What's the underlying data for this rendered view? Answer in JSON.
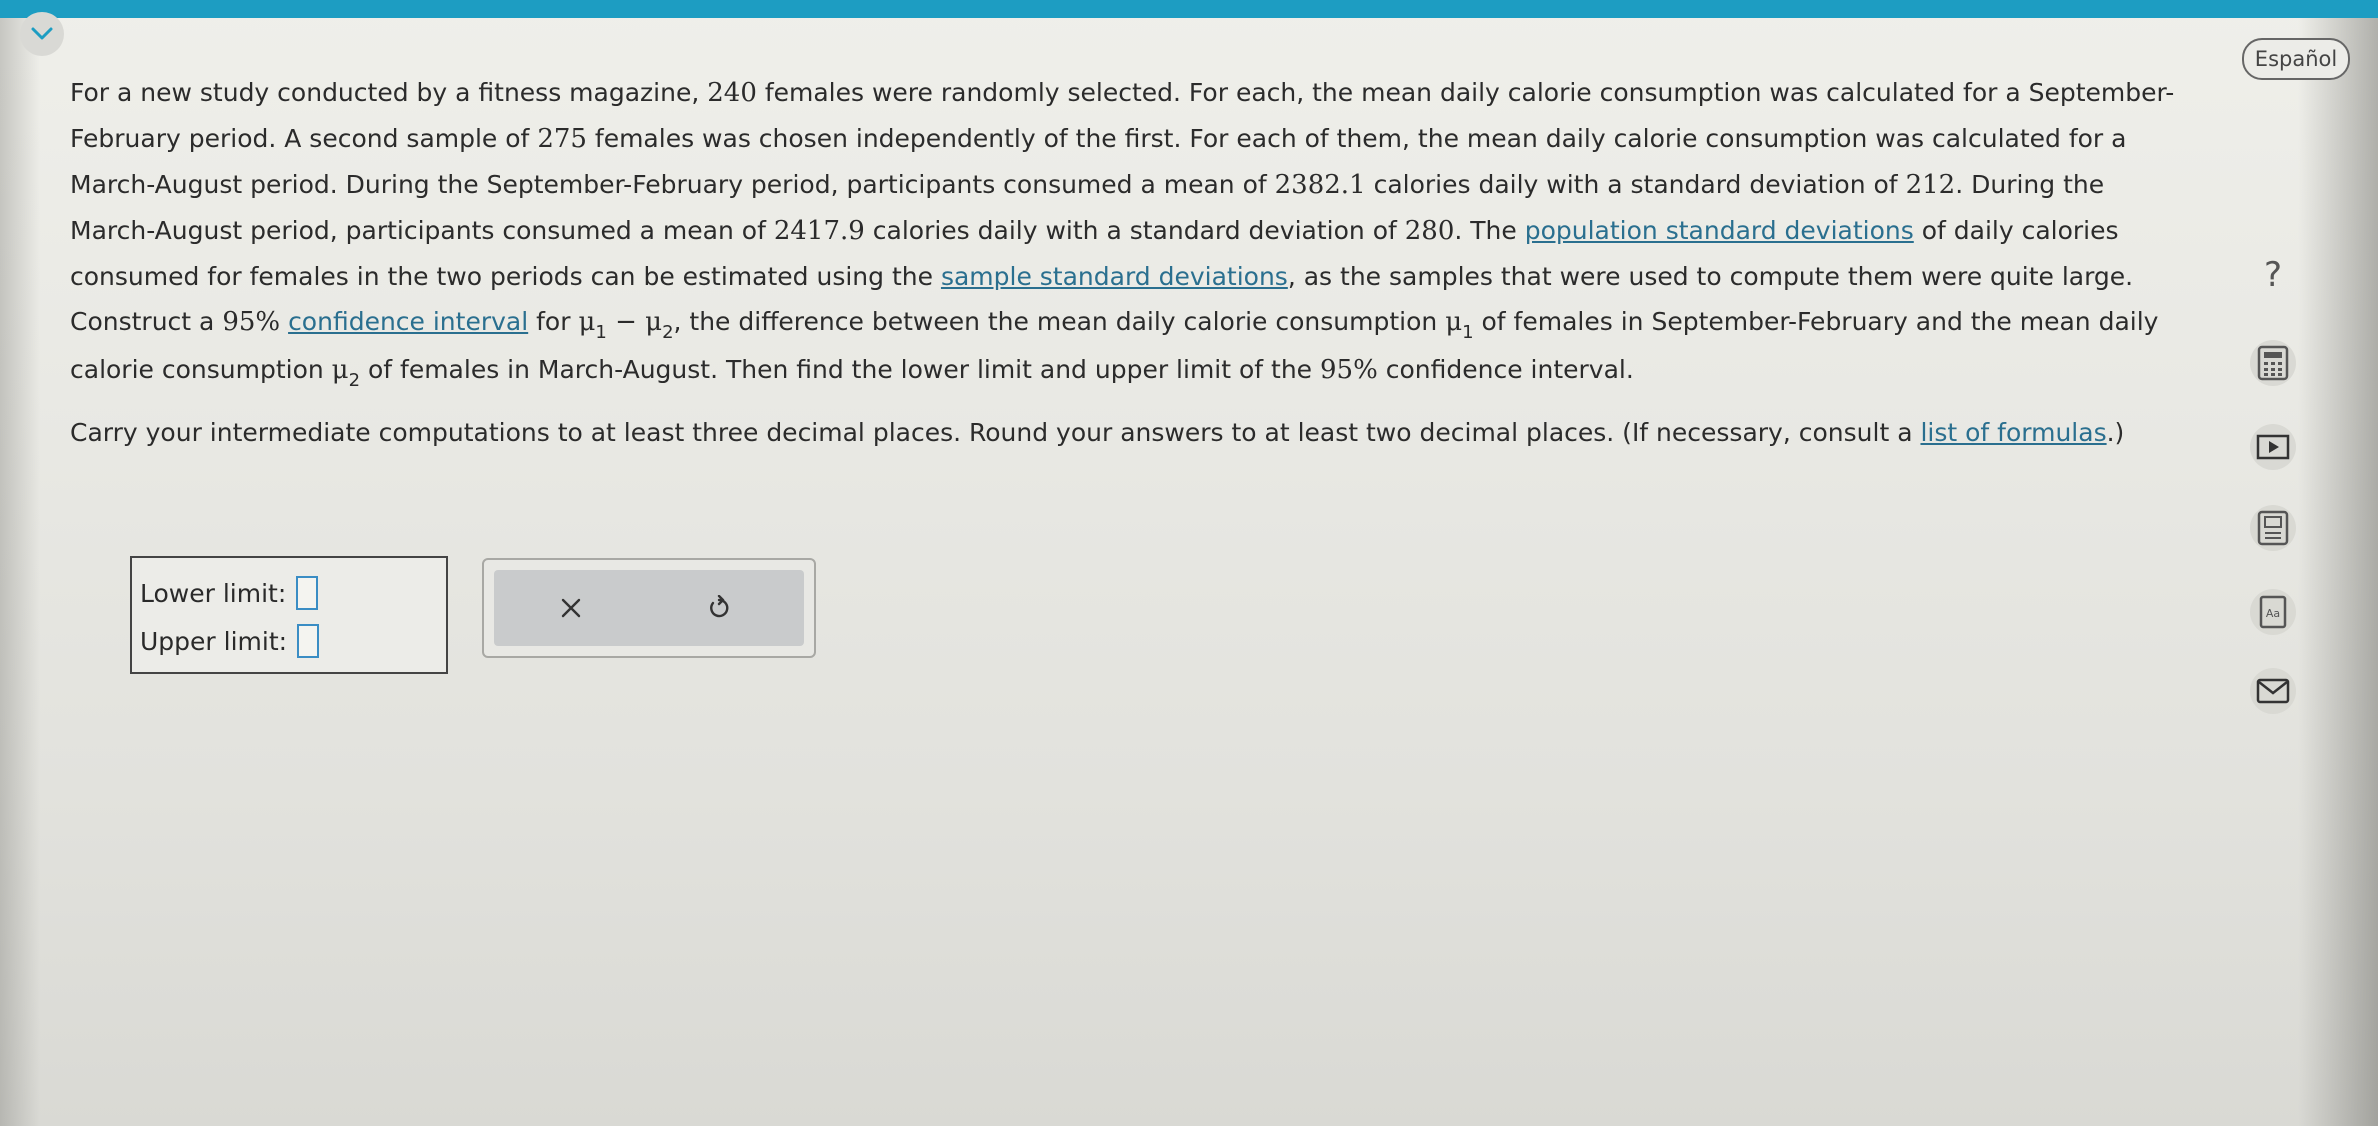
{
  "header": {
    "language_button": "Español",
    "collapse_icon": "chevron-down-icon"
  },
  "question": {
    "p1": "For a new study conducted by a fitness magazine, ",
    "n1": "240",
    "p2": " females were randomly selected. For each, the mean daily calorie consumption was calculated for a September-February period. A second sample of ",
    "n2": "275",
    "p3": " females was chosen independently of the first. For each of them, the mean daily calorie consumption was calculated for a March-August period. During the September-February period, participants consumed a mean of ",
    "mean1": "2382.1",
    "p4": " calories daily with a standard deviation of ",
    "sd1": "212",
    "p5": ". During the March-August period, participants consumed a mean of ",
    "mean2": "2417.9",
    "p6": " calories daily with a standard deviation of ",
    "sd2": "280",
    "p7": ". The ",
    "link_pop_sd": "population standard deviations",
    "p8": " of daily calories consumed for females in the two periods can be estimated using the ",
    "link_sample_sd": "sample standard deviations",
    "p9": ", as the samples that were used to compute them were quite large. Construct a ",
    "conf1": "95%",
    "p10": " ",
    "link_ci": "confidence interval",
    "p11": " for ",
    "mu": "μ",
    "sub1": "1",
    "sub2": "2",
    "minus": " − ",
    "p12": ", the difference between the mean daily calorie consumption ",
    "p13": " of females in September-February and the mean daily calorie consumption ",
    "p14": " of females in March-August. Then find the lower limit and upper limit of the ",
    "conf2": "95%",
    "p15": " confidence interval.",
    "inst1": "Carry your intermediate computations to at least three decimal places. Round your answers to at least two decimal places. (If necessary, consult a ",
    "link_formulas": "list of formulas",
    "inst2": ".)"
  },
  "answer": {
    "lower_label": "Lower limit:",
    "upper_label": "Upper limit:",
    "lower_value": "",
    "upper_value": ""
  },
  "actions": {
    "clear_icon": "close-icon",
    "undo_icon": "undo-icon"
  },
  "toolbar": {
    "icons": [
      "help-icon",
      "calculator-icon",
      "video-icon",
      "data-icon",
      "glossary-icon",
      "mail-icon"
    ],
    "help_glyph": "?",
    "glossary_text": "Aa"
  },
  "colors": {
    "accent": "#1d9dc2",
    "link": "#2a6f8f",
    "input_border": "#3a8dc4"
  }
}
